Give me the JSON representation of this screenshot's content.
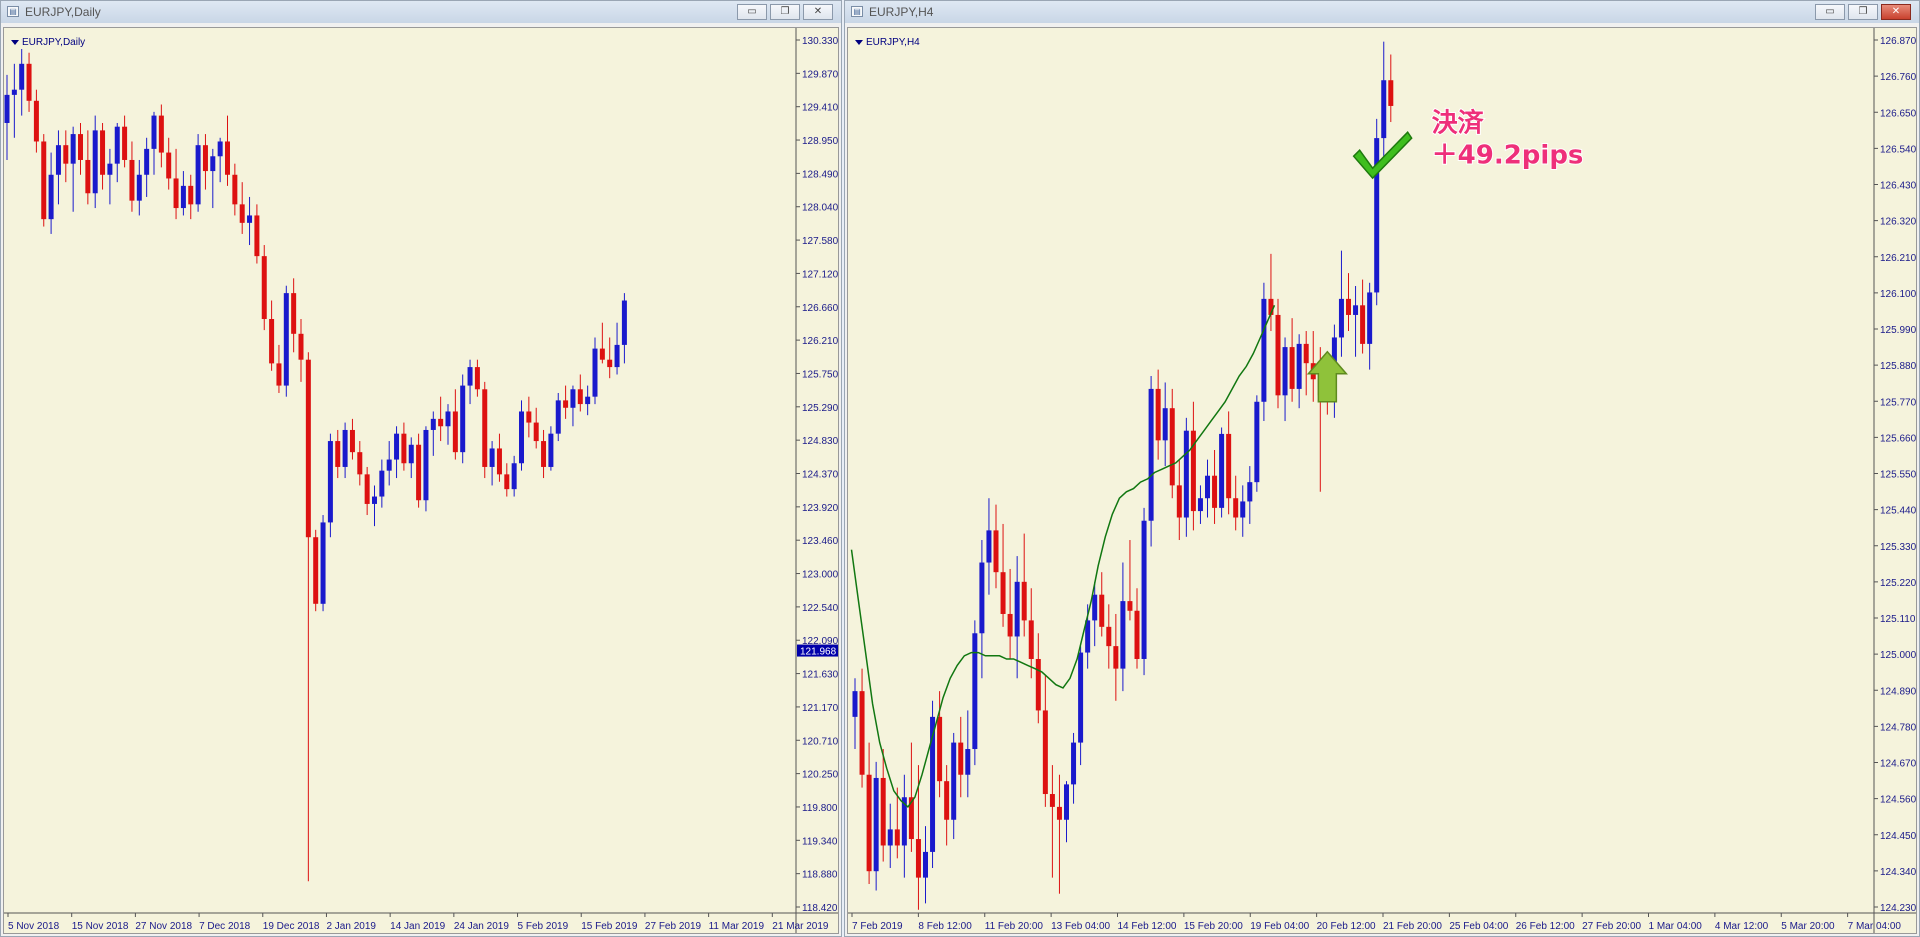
{
  "windows": [
    {
      "title": "EURJPY,Daily",
      "chart_label": "EURJPY,Daily",
      "price_badge": "121.968",
      "y_ticks": [
        "130.330",
        "129.870",
        "129.410",
        "128.950",
        "128.490",
        "128.040",
        "127.580",
        "127.120",
        "126.660",
        "126.210",
        "125.750",
        "125.290",
        "124.830",
        "124.370",
        "123.920",
        "123.460",
        "123.000",
        "122.540",
        "122.090",
        "121.630",
        "121.170",
        "120.710",
        "120.250",
        "119.800",
        "119.340",
        "118.880",
        "118.420"
      ],
      "x_ticks": [
        "5 Nov 2018",
        "15 Nov 2018",
        "27 Nov 2018",
        "7 Dec 2018",
        "19 Dec 2018",
        "2 Jan 2019",
        "14 Jan 2019",
        "24 Jan 2019",
        "5 Feb 2019",
        "15 Feb 2019",
        "27 Feb 2019",
        "11 Mar 2019",
        "21 Mar 2019"
      ]
    },
    {
      "title": "EURJPY,H4",
      "chart_label": "EURJPY,H4",
      "y_ticks": [
        "126.870",
        "126.760",
        "126.650",
        "126.540",
        "126.430",
        "126.320",
        "126.210",
        "126.100",
        "125.990",
        "125.880",
        "125.770",
        "125.660",
        "125.550",
        "125.440",
        "125.330",
        "125.220",
        "125.110",
        "125.000",
        "124.890",
        "124.780",
        "124.670",
        "124.560",
        "124.450",
        "124.340",
        "124.230"
      ],
      "x_ticks": [
        "7 Feb 2019",
        "8 Feb 12:00",
        "11 Feb 20:00",
        "13 Feb 04:00",
        "14 Feb 12:00",
        "15 Feb 20:00",
        "19 Feb 04:00",
        "20 Feb 12:00",
        "21 Feb 20:00",
        "25 Feb 04:00",
        "26 Feb 12:00",
        "27 Feb 20:00",
        "1 Mar 04:00",
        "4 Mar 12:00",
        "5 Mar 20:00",
        "7 Mar 04:00"
      ],
      "annotation_line1": "決済",
      "annotation_line2": "＋49.2pips"
    }
  ],
  "colors": {
    "bull": "#1a1acc",
    "bear": "#dd1111",
    "ma": "#117711",
    "background": "#f5f3dc"
  },
  "chart_data": [
    {
      "type": "candlestick",
      "symbol": "EURJPY",
      "timeframe": "Daily",
      "ylim": [
        118.42,
        130.33
      ],
      "xlabel": "",
      "ylabel": "",
      "last_price": 121.968,
      "ohlc": [
        [
          129.1,
          129.75,
          128.6,
          129.48
        ],
        [
          129.48,
          129.9,
          128.9,
          129.55
        ],
        [
          129.55,
          130.1,
          129.2,
          129.9
        ],
        [
          129.9,
          130.05,
          129.25,
          129.4
        ],
        [
          129.4,
          129.55,
          128.7,
          128.85
        ],
        [
          128.85,
          128.95,
          127.7,
          127.8
        ],
        [
          127.8,
          128.7,
          127.6,
          128.4
        ],
        [
          128.4,
          129.0,
          128.0,
          128.8
        ],
        [
          128.8,
          129.0,
          128.3,
          128.55
        ],
        [
          128.55,
          129.05,
          127.9,
          128.95
        ],
        [
          128.95,
          129.1,
          128.4,
          128.6
        ],
        [
          128.6,
          129.0,
          128.0,
          128.15
        ],
        [
          128.15,
          129.2,
          127.95,
          129.0
        ],
        [
          129.0,
          129.1,
          128.2,
          128.4
        ],
        [
          128.4,
          128.75,
          128.0,
          128.55
        ],
        [
          128.55,
          129.1,
          128.3,
          129.05
        ],
        [
          129.05,
          129.2,
          128.5,
          128.6
        ],
        [
          128.6,
          128.85,
          127.9,
          128.05
        ],
        [
          128.05,
          128.6,
          127.85,
          128.4
        ],
        [
          128.4,
          128.9,
          128.1,
          128.75
        ],
        [
          128.75,
          129.25,
          128.4,
          129.2
        ],
        [
          129.2,
          129.35,
          128.5,
          128.7
        ],
        [
          128.7,
          128.9,
          128.2,
          128.35
        ],
        [
          128.35,
          128.75,
          127.8,
          127.95
        ],
        [
          127.95,
          128.45,
          127.85,
          128.25
        ],
        [
          128.25,
          128.4,
          127.8,
          128.0
        ],
        [
          128.0,
          128.95,
          127.9,
          128.8
        ],
        [
          128.8,
          128.95,
          128.2,
          128.45
        ],
        [
          128.45,
          128.75,
          127.95,
          128.65
        ],
        [
          128.65,
          128.9,
          128.3,
          128.85
        ],
        [
          128.85,
          129.2,
          128.25,
          128.4
        ],
        [
          128.4,
          128.55,
          127.85,
          128.0
        ],
        [
          128.0,
          128.3,
          127.6,
          127.75
        ],
        [
          127.75,
          128.1,
          127.45,
          127.85
        ],
        [
          127.85,
          128.0,
          127.2,
          127.3
        ],
        [
          127.3,
          127.45,
          126.3,
          126.45
        ],
        [
          126.45,
          126.7,
          125.75,
          125.85
        ],
        [
          125.85,
          126.1,
          125.45,
          125.55
        ],
        [
          125.55,
          126.9,
          125.4,
          126.8
        ],
        [
          126.8,
          127.0,
          126.0,
          126.25
        ],
        [
          126.25,
          126.45,
          125.6,
          125.9
        ],
        [
          125.9,
          126.0,
          118.85,
          123.5
        ],
        [
          123.5,
          123.6,
          122.5,
          122.6
        ],
        [
          122.6,
          123.8,
          122.5,
          123.7
        ],
        [
          123.7,
          124.9,
          123.5,
          124.8
        ],
        [
          124.8,
          124.95,
          124.3,
          124.45
        ],
        [
          124.45,
          125.05,
          124.3,
          124.95
        ],
        [
          124.95,
          125.1,
          124.55,
          124.65
        ],
        [
          124.65,
          124.8,
          124.2,
          124.35
        ],
        [
          124.35,
          124.45,
          123.8,
          123.95
        ],
        [
          123.95,
          124.2,
          123.65,
          124.05
        ],
        [
          124.05,
          124.55,
          123.9,
          124.4
        ],
        [
          124.4,
          124.8,
          124.2,
          124.55
        ],
        [
          124.55,
          125.0,
          124.3,
          124.9
        ],
        [
          124.9,
          125.05,
          124.4,
          124.5
        ],
        [
          124.5,
          124.85,
          124.3,
          124.75
        ],
        [
          124.75,
          124.9,
          123.9,
          124.0
        ],
        [
          124.0,
          125.0,
          123.85,
          124.95
        ],
        [
          124.95,
          125.2,
          124.6,
          125.1
        ],
        [
          125.1,
          125.4,
          124.8,
          125.0
        ],
        [
          125.0,
          125.3,
          124.75,
          125.2
        ],
        [
          125.2,
          125.5,
          124.55,
          124.65
        ],
        [
          124.65,
          125.7,
          124.5,
          125.55
        ],
        [
          125.55,
          125.9,
          125.3,
          125.8
        ],
        [
          125.8,
          125.9,
          125.4,
          125.5
        ],
        [
          125.5,
          125.6,
          124.3,
          124.45
        ],
        [
          124.45,
          124.8,
          124.2,
          124.7
        ],
        [
          124.7,
          124.9,
          124.25,
          124.35
        ],
        [
          124.35,
          124.5,
          124.05,
          124.15
        ],
        [
          124.15,
          124.6,
          124.05,
          124.5
        ],
        [
          124.5,
          125.35,
          124.4,
          125.2
        ],
        [
          125.2,
          125.4,
          124.85,
          125.05
        ],
        [
          125.05,
          125.25,
          124.7,
          124.8
        ],
        [
          124.8,
          124.95,
          124.3,
          124.45
        ],
        [
          124.45,
          125.0,
          124.4,
          124.9
        ],
        [
          124.9,
          125.45,
          124.8,
          125.35
        ],
        [
          125.35,
          125.55,
          125.1,
          125.25
        ],
        [
          125.25,
          125.55,
          125.0,
          125.5
        ],
        [
          125.5,
          125.7,
          125.2,
          125.3
        ],
        [
          125.3,
          125.55,
          125.15,
          125.4
        ],
        [
          125.4,
          126.2,
          125.3,
          126.05
        ],
        [
          126.05,
          126.4,
          125.85,
          125.9
        ],
        [
          125.9,
          126.2,
          125.65,
          125.8
        ],
        [
          125.8,
          126.4,
          125.7,
          126.1
        ],
        [
          126.1,
          126.8,
          125.85,
          126.7
        ]
      ]
    },
    {
      "type": "candlestick",
      "symbol": "EURJPY",
      "timeframe": "H4",
      "ylim": [
        124.19,
        126.93
      ],
      "xlabel": "",
      "ylabel": "",
      "ohlc": [
        [
          124.8,
          124.92,
          124.7,
          124.88
        ],
        [
          124.88,
          124.95,
          124.58,
          124.62
        ],
        [
          124.62,
          124.72,
          124.28,
          124.32
        ],
        [
          124.32,
          124.66,
          124.26,
          124.61
        ],
        [
          124.61,
          124.7,
          124.35,
          124.4
        ],
        [
          124.4,
          124.53,
          124.33,
          124.45
        ],
        [
          124.45,
          124.58,
          124.36,
          124.4
        ],
        [
          124.4,
          124.62,
          124.3,
          124.55
        ],
        [
          124.55,
          124.72,
          124.38,
          124.42
        ],
        [
          124.42,
          124.65,
          124.2,
          124.3
        ],
        [
          124.3,
          124.46,
          124.22,
          124.38
        ],
        [
          124.38,
          124.85,
          124.33,
          124.8
        ],
        [
          124.8,
          124.88,
          124.55,
          124.6
        ],
        [
          124.6,
          124.65,
          124.4,
          124.48
        ],
        [
          124.48,
          124.75,
          124.42,
          124.72
        ],
        [
          124.72,
          124.8,
          124.55,
          124.62
        ],
        [
          124.62,
          124.82,
          124.55,
          124.7
        ],
        [
          124.7,
          125.1,
          124.65,
          125.06
        ],
        [
          125.06,
          125.35,
          124.92,
          125.28
        ],
        [
          125.28,
          125.48,
          125.18,
          125.38
        ],
        [
          125.38,
          125.46,
          125.2,
          125.25
        ],
        [
          125.25,
          125.4,
          125.08,
          125.12
        ],
        [
          125.12,
          125.26,
          124.98,
          125.05
        ],
        [
          125.05,
          125.3,
          124.92,
          125.22
        ],
        [
          125.22,
          125.37,
          125.05,
          125.1
        ],
        [
          125.1,
          125.2,
          124.92,
          124.98
        ],
        [
          124.98,
          125.06,
          124.78,
          124.82
        ],
        [
          124.82,
          124.93,
          124.52,
          124.56
        ],
        [
          124.56,
          124.65,
          124.3,
          124.52
        ],
        [
          124.52,
          124.62,
          124.25,
          124.48
        ],
        [
          124.48,
          124.6,
          124.41,
          124.59
        ],
        [
          124.59,
          124.75,
          124.53,
          124.72
        ],
        [
          124.72,
          125.02,
          124.65,
          125.0
        ],
        [
          125.0,
          125.15,
          124.95,
          125.1
        ],
        [
          125.1,
          125.22,
          125.02,
          125.18
        ],
        [
          125.18,
          125.25,
          125.05,
          125.08
        ],
        [
          125.08,
          125.15,
          124.95,
          125.02
        ],
        [
          125.02,
          125.12,
          124.85,
          124.95
        ],
        [
          124.95,
          125.28,
          124.88,
          125.16
        ],
        [
          125.16,
          125.35,
          125.1,
          125.13
        ],
        [
          125.13,
          125.2,
          124.95,
          124.98
        ],
        [
          124.98,
          125.45,
          124.93,
          125.41
        ],
        [
          125.41,
          125.86,
          125.33,
          125.82
        ],
        [
          125.82,
          125.88,
          125.6,
          125.66
        ],
        [
          125.66,
          125.84,
          125.58,
          125.76
        ],
        [
          125.76,
          125.82,
          125.48,
          125.52
        ],
        [
          125.52,
          125.6,
          125.35,
          125.42
        ],
        [
          125.42,
          125.73,
          125.36,
          125.69
        ],
        [
          125.69,
          125.78,
          125.38,
          125.44
        ],
        [
          125.44,
          125.52,
          125.4,
          125.48
        ],
        [
          125.48,
          125.6,
          125.42,
          125.55
        ],
        [
          125.55,
          125.63,
          125.4,
          125.45
        ],
        [
          125.45,
          125.7,
          125.42,
          125.68
        ],
        [
          125.68,
          125.75,
          125.43,
          125.48
        ],
        [
          125.48,
          125.55,
          125.38,
          125.42
        ],
        [
          125.42,
          125.52,
          125.36,
          125.47
        ],
        [
          125.47,
          125.58,
          125.4,
          125.53
        ],
        [
          125.53,
          125.8,
          125.5,
          125.78
        ],
        [
          125.78,
          126.15,
          125.72,
          126.1
        ],
        [
          126.1,
          126.24,
          126.0,
          126.05
        ],
        [
          126.05,
          126.1,
          125.76,
          125.8
        ],
        [
          125.8,
          125.98,
          125.72,
          125.95
        ],
        [
          125.95,
          126.04,
          125.78,
          125.82
        ],
        [
          125.82,
          125.99,
          125.76,
          125.96
        ],
        [
          125.96,
          126.0,
          125.8,
          125.9
        ],
        [
          125.9,
          126.0,
          125.78,
          125.85
        ],
        [
          125.85,
          125.95,
          125.5,
          125.8
        ],
        [
          125.8,
          125.92,
          125.74,
          125.78
        ],
        [
          125.78,
          126.02,
          125.73,
          125.98
        ],
        [
          125.98,
          126.25,
          125.92,
          126.1
        ],
        [
          126.1,
          126.18,
          126.0,
          126.05
        ],
        [
          126.05,
          126.14,
          125.92,
          126.08
        ],
        [
          126.08,
          126.16,
          125.93,
          125.96
        ],
        [
          125.96,
          126.15,
          125.88,
          126.12
        ],
        [
          126.12,
          126.66,
          126.08,
          126.6
        ],
        [
          126.6,
          126.9,
          126.53,
          126.78
        ],
        [
          126.78,
          126.86,
          126.65,
          126.7
        ]
      ],
      "ma": [
        125.32,
        125.16,
        125.0,
        124.84,
        124.72,
        124.64,
        124.57,
        124.54,
        124.52,
        124.55,
        124.62,
        124.7,
        124.78,
        124.86,
        124.92,
        124.96,
        124.99,
        125.0,
        125.0,
        124.99,
        124.99,
        124.99,
        124.98,
        124.98,
        124.97,
        124.96,
        124.95,
        124.94,
        124.92,
        124.9,
        124.89,
        124.92,
        124.98,
        125.07,
        125.16,
        125.27,
        125.36,
        125.43,
        125.48,
        125.5,
        125.51,
        125.53,
        125.54,
        125.56,
        125.57,
        125.58,
        125.59,
        125.61,
        125.63,
        125.66,
        125.69,
        125.72,
        125.75,
        125.78,
        125.82,
        125.86,
        125.89,
        125.93,
        125.98,
        126.03,
        126.08
      ]
    }
  ]
}
